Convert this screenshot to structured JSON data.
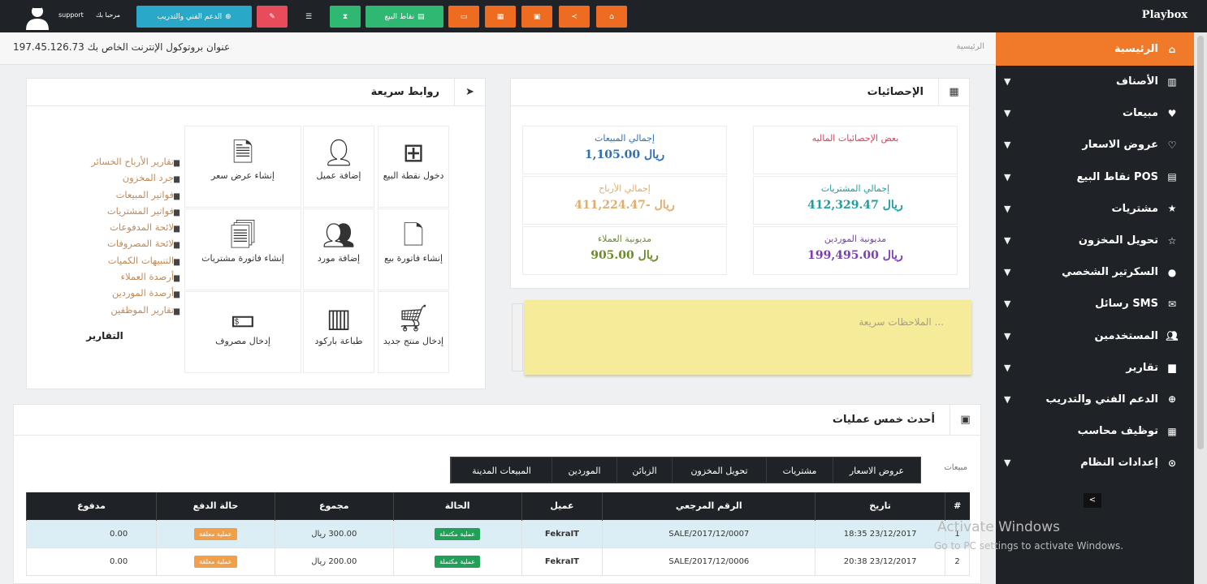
{
  "app": {
    "brand": "Playbox"
  },
  "topbar": {
    "user_name": "support",
    "welcome": "مرحبا بك",
    "support_button": "الدعم الفني والتدريب",
    "pos_button": "نقاط البيع"
  },
  "breadcrumb": {
    "home": "الرئيسية"
  },
  "ip": {
    "label": "عنوان بروتوكول الإنترنت الخاص بك",
    "value": "197.45.126.73"
  },
  "sidebar": {
    "items": [
      {
        "label": "الرئيسية",
        "icon": "home-icon"
      },
      {
        "label": "الأصناف",
        "icon": "barcode-icon"
      },
      {
        "label": "مبيعات",
        "icon": "heart-icon"
      },
      {
        "label": "عروض الاسعار",
        "icon": "heart-outline-icon"
      },
      {
        "label": "نقاط البيع POS",
        "icon": "register-icon"
      },
      {
        "label": "مشتريات",
        "icon": "star-icon"
      },
      {
        "label": "تحويل المخزون",
        "icon": "star-outline-icon"
      },
      {
        "label": "السكرتير الشخصي",
        "icon": "user-icon"
      },
      {
        "label": "رسائل SMS",
        "icon": "envelope-icon"
      },
      {
        "label": "المستخدمين",
        "icon": "users-icon"
      },
      {
        "label": "تقارير",
        "icon": "chart-icon"
      },
      {
        "label": "الدعم الفني والتدريب",
        "icon": "plus-circle-icon"
      },
      {
        "label": "توظيف محاسب",
        "icon": "calculator-icon"
      },
      {
        "label": "إعدادات النظام",
        "icon": "cog-circle-icon"
      }
    ],
    "collapse": "<"
  },
  "stats_panel": {
    "title": "الإحصائيات",
    "subtitle": "بعض الإحصائيات الماليه",
    "total_sales_label": "إجمالي المبيعات",
    "total_sales_value": "1,105.00 ريال",
    "total_profit_label": "إجمالي الأرباح",
    "total_profit_value": "411,224.47- ريال",
    "customer_debt_label": "مديونية العملاء",
    "customer_debt_value": "905.00 ريال",
    "total_purchases_label": "إجمالي المشتريات",
    "total_purchases_value": "412,329.47 ريال",
    "supplier_debt_label": "مديونية الموردين",
    "supplier_debt_value": "199,495.00 ريال"
  },
  "notes": {
    "placeholder": "الملاحظات سريعة ..."
  },
  "quick_links": {
    "title": "روابط سريعة",
    "tiles": [
      {
        "label": "دخول نقطة البيع",
        "icon": "windows-icon"
      },
      {
        "label": "إضافة عميل",
        "icon": "add-user-icon"
      },
      {
        "label": "إنشاء عرض سعر",
        "icon": "document-icon"
      },
      {
        "label": "إنشاء فاتورة بيع",
        "icon": "pdf-icon"
      },
      {
        "label": "إضافة مورد",
        "icon": "group-icon"
      },
      {
        "label": "إنشاء فاتورة مشتريات",
        "icon": "file-text-icon"
      },
      {
        "label": "إدخال منتج جديد",
        "icon": "cart-plus-icon"
      },
      {
        "label": "طباعة باركود",
        "icon": "barcode-icon"
      },
      {
        "label": "إدخال مصروف",
        "icon": "money-icon"
      }
    ],
    "reports_title": "التقارير",
    "reports": [
      "تقارير الأرباح الخسائر",
      "جرد المخزون",
      "فواتير المبيعات",
      "فواتير المشتريات",
      "لائحة المدفوعات",
      "لائحة المصروفات",
      "التنبيهات الكميات",
      "أرصدة العملاء",
      "أرصدة الموردين",
      "تقارير الموظفين"
    ]
  },
  "recent": {
    "title": "أحدث خمس عمليات",
    "side_label": "مبيعات",
    "tabs": [
      "عروض الاسعار",
      "مشتريات",
      "تحويل المخزون",
      "الزبائن",
      "الموردين",
      "المبيعات المدينة"
    ],
    "columns": [
      "#",
      "تاريخ",
      "الرقم المرجعي",
      "عميل",
      "الحالة",
      "مجموع",
      "حالة الدفع",
      "مدفوع"
    ],
    "rows": [
      {
        "num": "1",
        "date": "23/12/2017 18:35",
        "ref": "SALE/2017/12/0007",
        "customer": "FekraIT",
        "status": "عملية مكتملة",
        "total": "300.00 ريال",
        "payment": "عملية معلقة",
        "paid": "0.00"
      },
      {
        "num": "2",
        "date": "23/12/2017 20:38",
        "ref": "SALE/2017/12/0006",
        "customer": "FekraIT",
        "status": "عملية مكتملة",
        "total": "200.00 ريال",
        "payment": "عملية معلقة",
        "paid": "0.00"
      }
    ]
  },
  "watermark": {
    "line1": "Activate Windows",
    "line2": "Go to PC settings to activate Windows."
  },
  "colors": {
    "accent": "#f07a2a",
    "dark": "#1f2327",
    "green": "#2eb872",
    "red": "#e84c5a",
    "teal": "#29a9c7",
    "orange_btn": "#ed6c21",
    "status_green": "#22a05a",
    "pending_orange": "#f0a04b"
  }
}
